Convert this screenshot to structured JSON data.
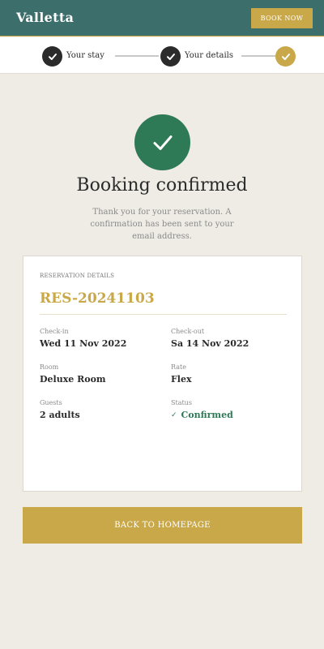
{
  "header": {
    "brand": "Valletta",
    "book_now": "BOOK NOW"
  },
  "stepper": {
    "steps": [
      {
        "label": "Your stay",
        "state": "complete"
      },
      {
        "label": "Your details",
        "state": "complete"
      },
      {
        "label": "",
        "state": "current"
      }
    ]
  },
  "confirmation": {
    "title": "Booking confirmed",
    "message": "Thank you for your reservation. A confirmation has been sent to your email address."
  },
  "reservation": {
    "section_label": "RESERVATION DETAILS",
    "reference": "RES-20241103",
    "fields": {
      "checkin": {
        "label": "Check-in",
        "value": "Wed 11 Nov 2022"
      },
      "checkout": {
        "label": "Check-out",
        "value": "Sa 14 Nov 2022"
      },
      "room": {
        "label": "Room",
        "value": "Deluxe Room"
      },
      "rate": {
        "label": "Rate",
        "value": "Flex"
      },
      "guests": {
        "label": "Guests",
        "value": "2 adults"
      },
      "status": {
        "label": "Status",
        "value": "Confirmed"
      }
    }
  },
  "actions": {
    "back_home": "BACK TO HOMEPAGE"
  },
  "colors": {
    "header_bg": "#3c6e6b",
    "accent_gold": "#c9a84a",
    "success_green": "#2e7a57",
    "page_bg": "#efece6"
  },
  "icons": {
    "step_complete": "check-icon",
    "success": "check-icon",
    "status": "check-icon"
  }
}
